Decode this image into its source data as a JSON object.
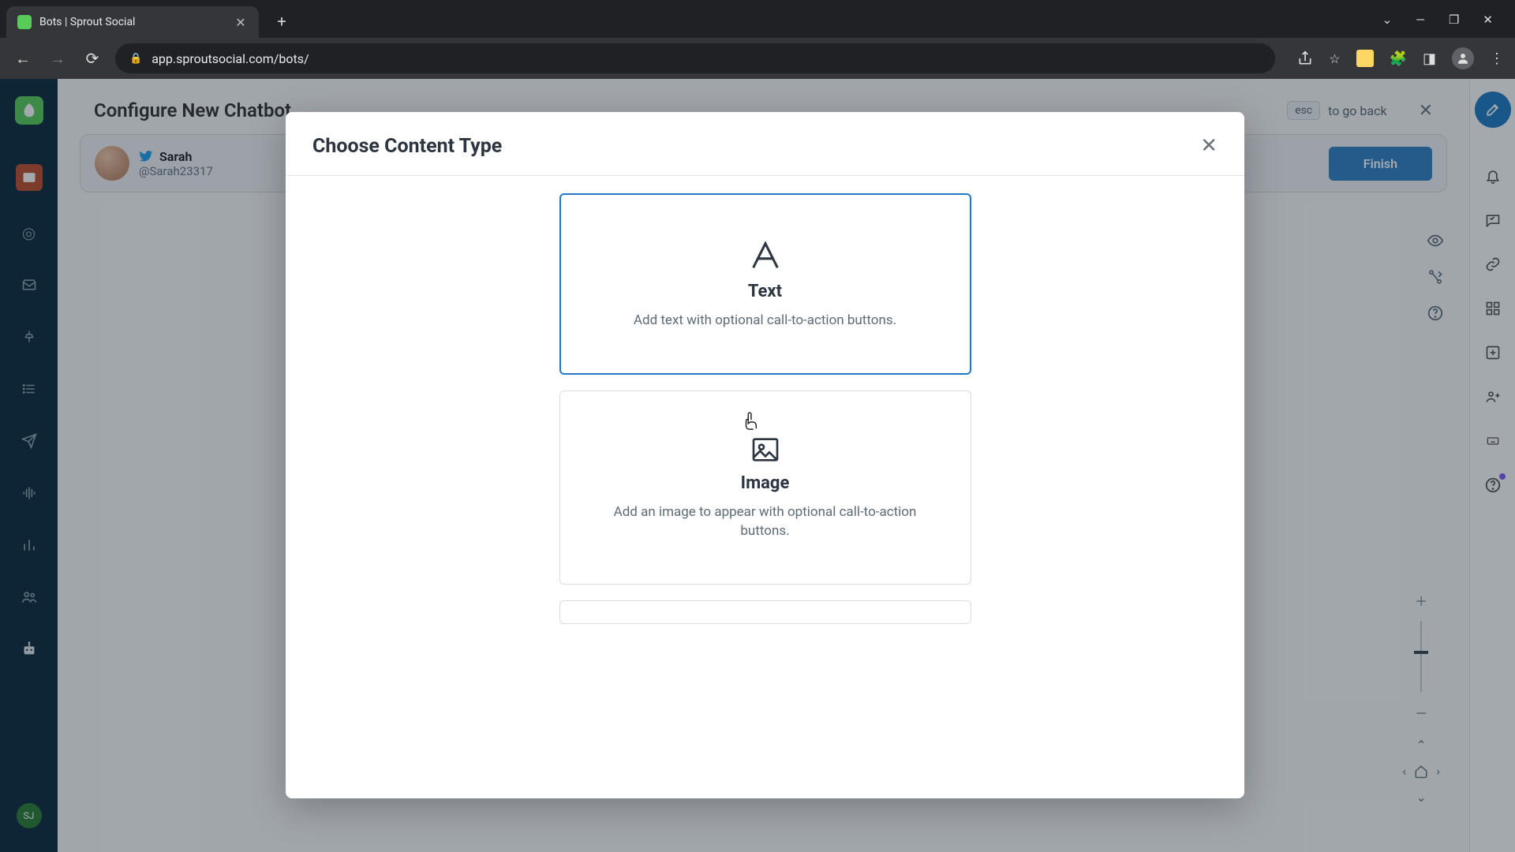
{
  "browser": {
    "tab_title": "Bots | Sprout Social",
    "url": "app.sproutsocial.com/bots/"
  },
  "page": {
    "title": "Configure New Chatbot",
    "esc_label": "esc",
    "go_back_label": "to go back",
    "user_name": "Sarah",
    "user_handle": "@Sarah23317",
    "finish_label": "Finish",
    "rail_avatar": "SJ"
  },
  "modal": {
    "title": "Choose Content Type",
    "options": [
      {
        "title": "Text",
        "desc": "Add text with optional call-to-action buttons."
      },
      {
        "title": "Image",
        "desc": "Add an image to appear with optional call-to-action buttons."
      }
    ]
  }
}
